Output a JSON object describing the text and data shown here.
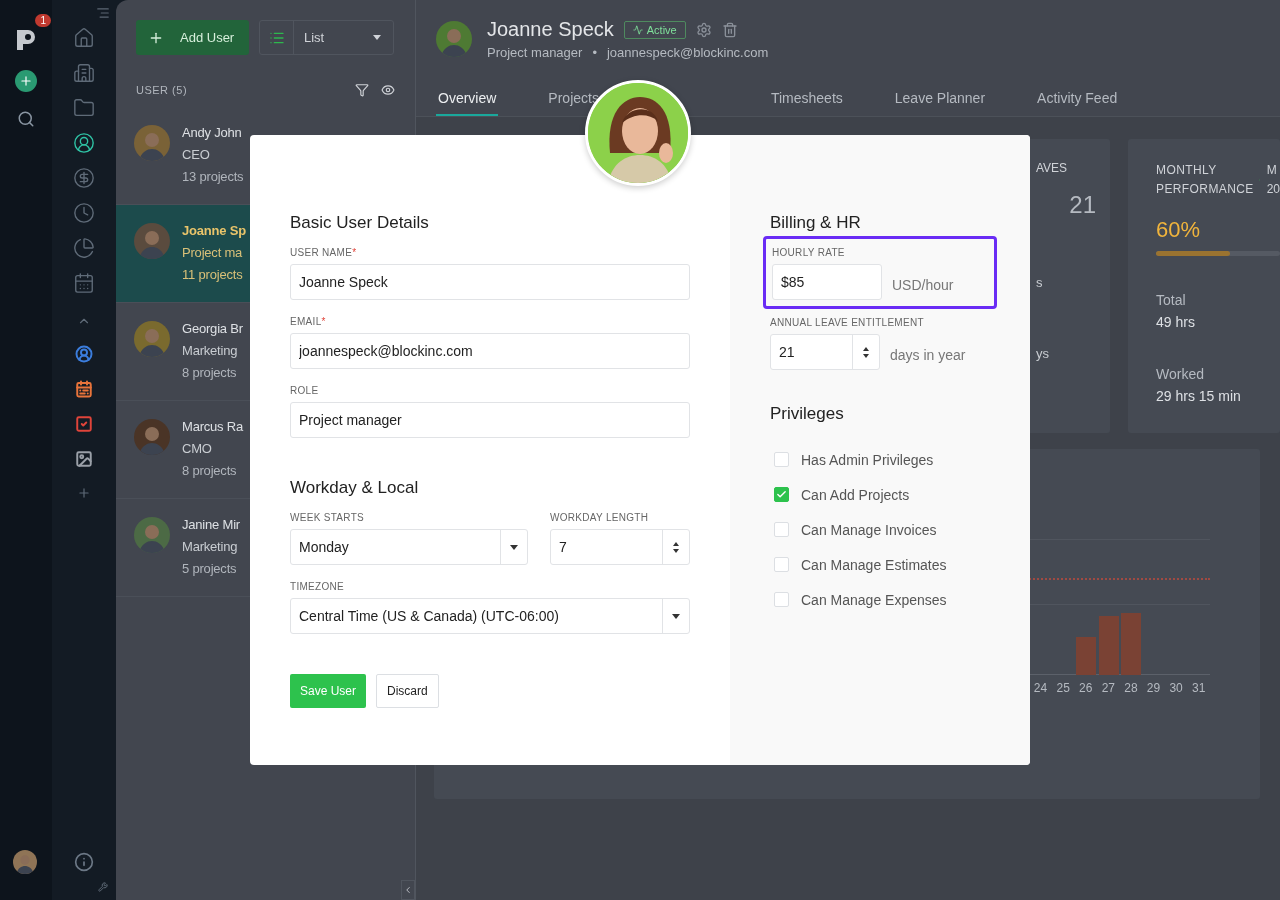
{
  "sidebar": {
    "badge": "1",
    "nav": [
      {
        "selected": false
      },
      {
        "selected": false
      },
      {
        "selected": false
      },
      {
        "selected": true
      },
      {
        "selected": false
      },
      {
        "selected": false
      },
      {
        "selected": false
      },
      {
        "selected": false
      }
    ],
    "shortcuts": [
      {
        "color": "#3b7ddd"
      },
      {
        "color": "#e8743b"
      },
      {
        "color": "#e0443a"
      },
      {
        "color": "#9aa0a8"
      }
    ]
  },
  "toolbar": {
    "add_button": "Add User",
    "view_select": "List"
  },
  "user_list": {
    "heading": "USER (5)",
    "users": [
      {
        "name": "Andy John",
        "role": "CEO",
        "projects": "13 projects",
        "selected": false
      },
      {
        "name": "Joanne Sp",
        "role": "Project ma",
        "projects": "11 projects",
        "selected": true
      },
      {
        "name": "Georgia Br",
        "role": "Marketing",
        "projects": "8 projects",
        "selected": false
      },
      {
        "name": "Marcus Ra",
        "role": "CMO",
        "projects": "8 projects",
        "selected": false
      },
      {
        "name": "Janine Mir",
        "role": "Marketing",
        "projects": "5 projects",
        "selected": false
      }
    ]
  },
  "profile": {
    "name": "Joanne Speck",
    "status": "Active",
    "role": "Project manager",
    "separator": "•",
    "email": "joannespeck@blockinc.com"
  },
  "tabs": [
    {
      "label": "Overview",
      "selected": true
    },
    {
      "label": "Projects",
      "selected": false
    },
    {
      "label": "Timesheets",
      "selected": false
    },
    {
      "label": "Leave Planner",
      "selected": false
    },
    {
      "label": "Activity Feed",
      "selected": false
    }
  ],
  "leaves_card": {
    "title": "AVES",
    "value": "21",
    "row_1": "s",
    "row_2": "ys"
  },
  "performance_card": {
    "title": "MONTHLY PERFORMANCE",
    "month": "M",
    "year": "20",
    "percent": "60%",
    "level": 0.6,
    "stats": [
      {
        "label": "Total",
        "value": "49 hrs"
      },
      {
        "label": "Worked",
        "value": "29 hrs 15 min"
      }
    ]
  },
  "chart": {
    "day_labels": [
      "24",
      "25",
      "26",
      "27",
      "28",
      "29",
      "30",
      "31"
    ]
  },
  "dialog": {
    "basic": {
      "title": "Basic User Details",
      "fields": [
        {
          "label": "USER NAME",
          "required_mark": "*",
          "value": "Joanne Speck"
        },
        {
          "label": "EMAIL",
          "required_mark": "*",
          "value": "joannespeck@blockinc.com"
        },
        {
          "label": "ROLE",
          "value": "Project manager"
        }
      ]
    },
    "workday": {
      "title": "Workday & Local",
      "week_starts": {
        "label": "WEEK STARTS",
        "value": "Monday"
      },
      "workday_length": {
        "label": "WORKDAY LENGTH",
        "value": "7"
      },
      "timezone": {
        "label": "TIMEZONE",
        "value": "Central Time (US & Canada) (UTC-06:00)"
      }
    },
    "buttons": {
      "save": "Save User",
      "discard": "Discard"
    },
    "billing": {
      "title": "Billing & HR",
      "hourly_rate": {
        "label": "HOURLY RATE",
        "value": "$85",
        "unit": "USD/hour",
        "highlighted": true
      },
      "leave": {
        "label": "ANNUAL LEAVE ENTITLEMENT",
        "value": "21",
        "unit": "days in year"
      }
    },
    "privileges": {
      "title": "Privileges",
      "items": [
        {
          "label": "Has Admin Privileges",
          "checked": false
        },
        {
          "label": "Can Add Projects",
          "checked": true
        },
        {
          "label": "Can Manage Invoices",
          "checked": false
        },
        {
          "label": "Can Manage Estimates",
          "checked": false
        },
        {
          "label": "Can Manage Expenses",
          "checked": false
        }
      ]
    }
  }
}
